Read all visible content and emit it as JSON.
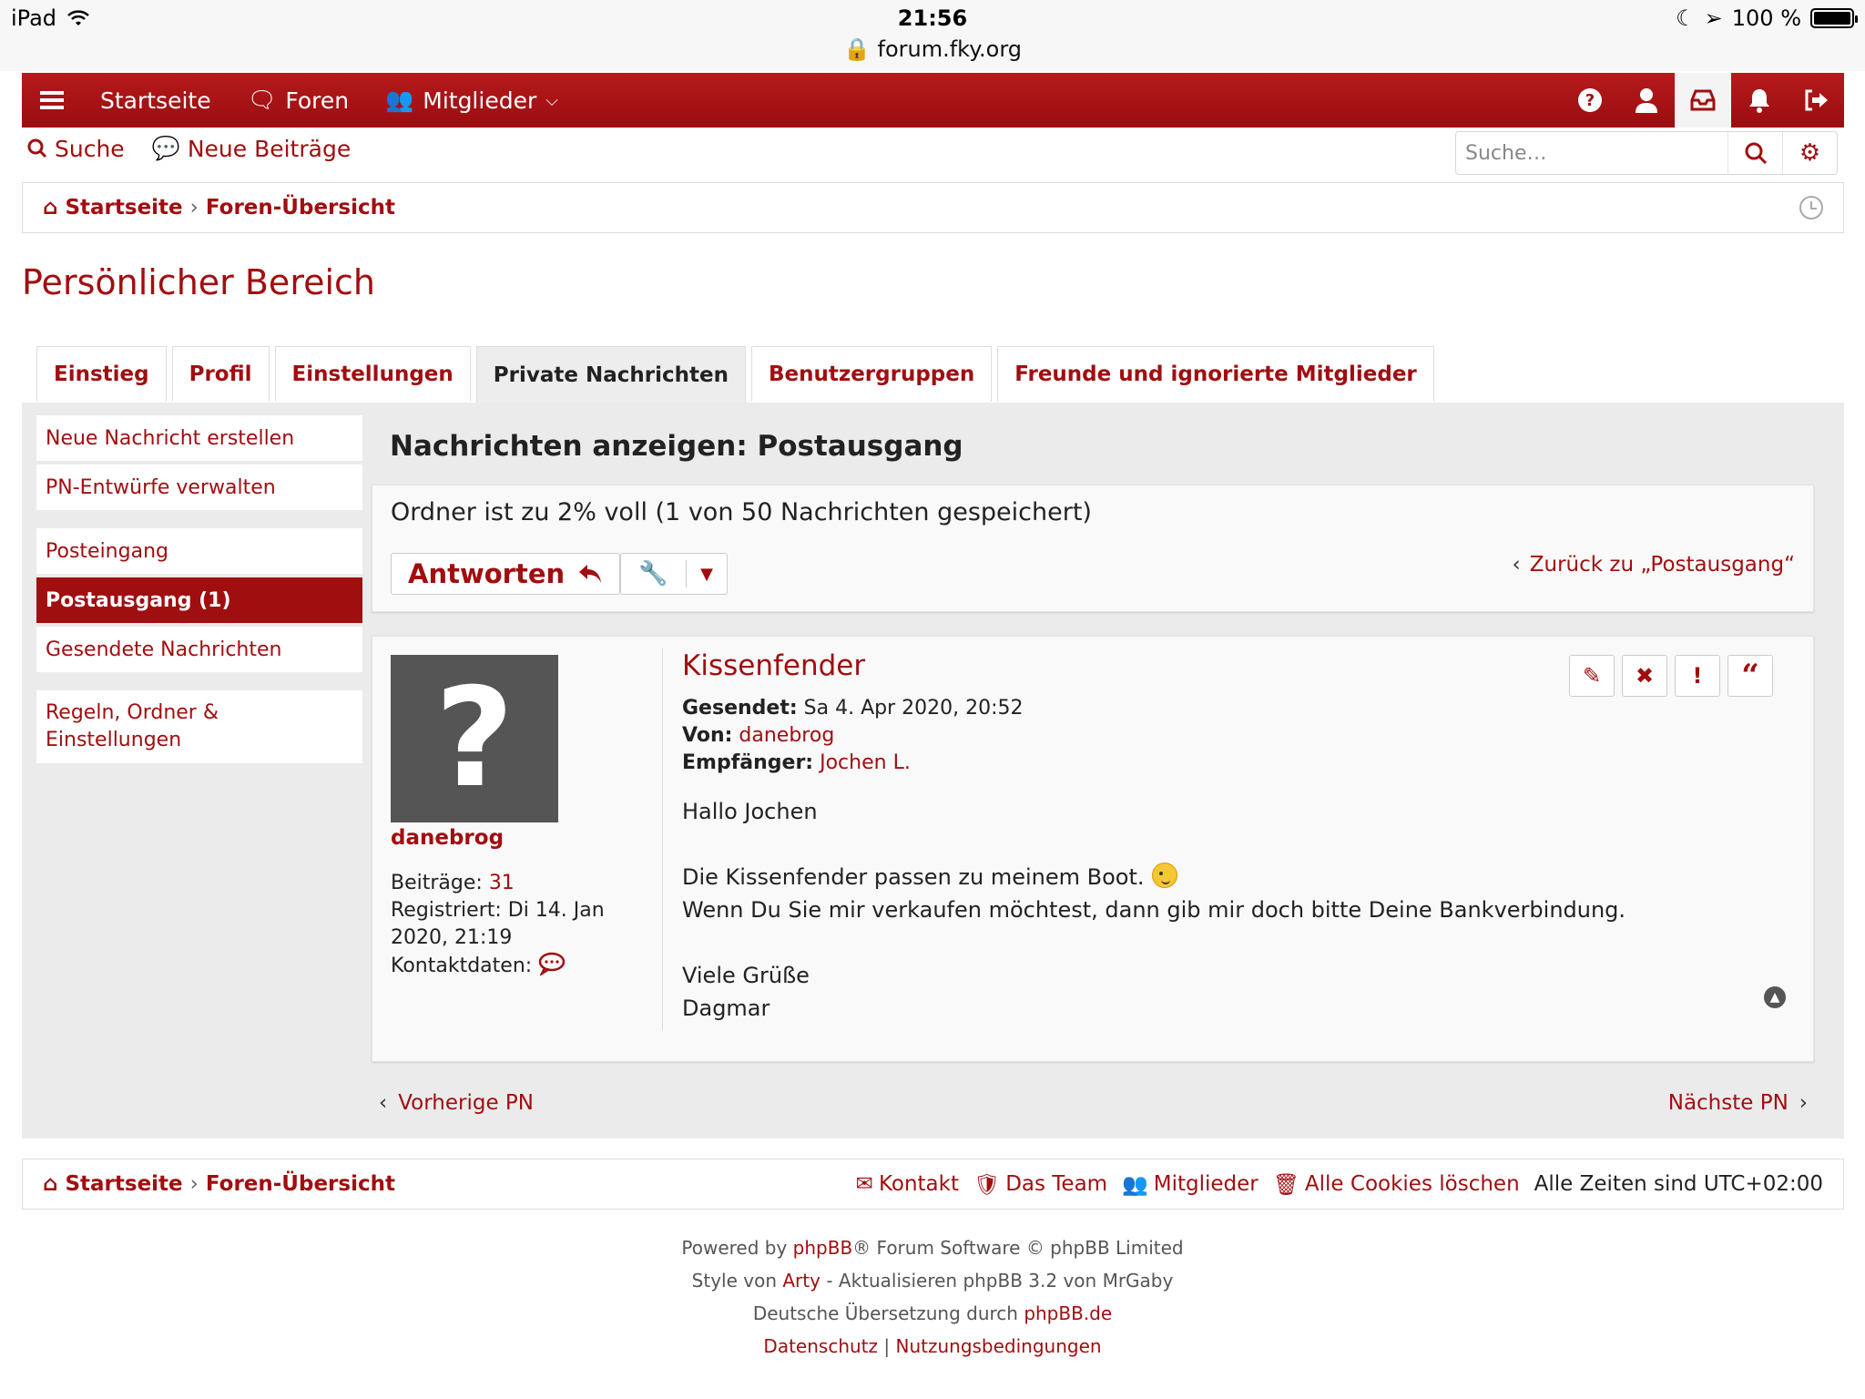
{
  "status_bar": {
    "device": "iPad",
    "time": "21:56",
    "url": "forum.fky.org",
    "battery": "100 %"
  },
  "navbar": {
    "home": "Startseite",
    "forums": "Foren",
    "members": "Mitglieder"
  },
  "subnav": {
    "search": "Suche",
    "new_posts": "Neue Beiträge",
    "search_placeholder": "Suche…"
  },
  "breadcrumb": {
    "home": "Startseite",
    "index": "Foren-Übersicht"
  },
  "page_title": "Persönlicher Bereich",
  "tabs": [
    "Einstieg",
    "Profil",
    "Einstellungen",
    "Private Nachrichten",
    "Benutzergruppen",
    "Freunde und ignorierte Mitglieder"
  ],
  "sidebar": {
    "compose": "Neue Nachricht erstellen",
    "drafts": "PN-Entwürfe verwalten",
    "inbox": "Posteingang",
    "outbox": "Postausgang (1)",
    "sent": "Gesendete Nachrichten",
    "rules": "Regeln, Ordner & Einstellungen"
  },
  "message_view": {
    "title": "Nachrichten anzeigen: Postausgang",
    "folder_status": "Ordner ist zu 2% voll (1 von 50 Nachrichten gespeichert)",
    "reply_label": "Antworten",
    "back_link": "Zurück zu „Postausgang“"
  },
  "author": {
    "avatar_glyph": "?",
    "name": "danebrog",
    "posts_label": "Beiträge:",
    "posts_value": "31",
    "registered": "Registriert: Di 14. Jan 2020, 21:19",
    "contact_label": "Kontaktdaten:"
  },
  "post": {
    "subject": "Kissenfender",
    "sent_label": "Gesendet:",
    "sent_value": "Sa 4. Apr 2020, 20:52",
    "from_label": "Von:",
    "from_value": "danebrog",
    "to_label": "Empfänger:",
    "to_value": "Jochen L.",
    "greeting": "Hallo Jochen",
    "line1": "Die Kissenfender passen zu meinem Boot.",
    "line2": "Wenn Du Sie mir verkaufen möchtest, dann gib mir doch bitte Deine Bankverbindung.",
    "closing1": "Viele Grüße",
    "closing2": "Dagmar"
  },
  "pm_nav": {
    "prev": "Vorherige PN",
    "next": "Nächste PN"
  },
  "footer": {
    "contact": "Kontakt",
    "team": "Das Team",
    "members": "Mitglieder",
    "cookies": "Alle Cookies löschen",
    "timezone": "Alle Zeiten sind UTC+02:00"
  },
  "copyright": {
    "powered_pre": "Powered by",
    "phpbb": "phpBB",
    "powered_post": "® Forum Software © phpBB Limited",
    "style_pre": "Style von",
    "style_author": "Arty",
    "style_post": "- Aktualisieren phpBB 3.2 von MrGaby",
    "translation_pre": "Deutsche Übersetzung durch",
    "translation_link": "phpBB.de",
    "privacy": "Datenschutz",
    "sep": "|",
    "terms": "Nutzungsbedingungen"
  },
  "colors": {
    "brand": "#a10e10",
    "panel": "#ebebeb"
  }
}
